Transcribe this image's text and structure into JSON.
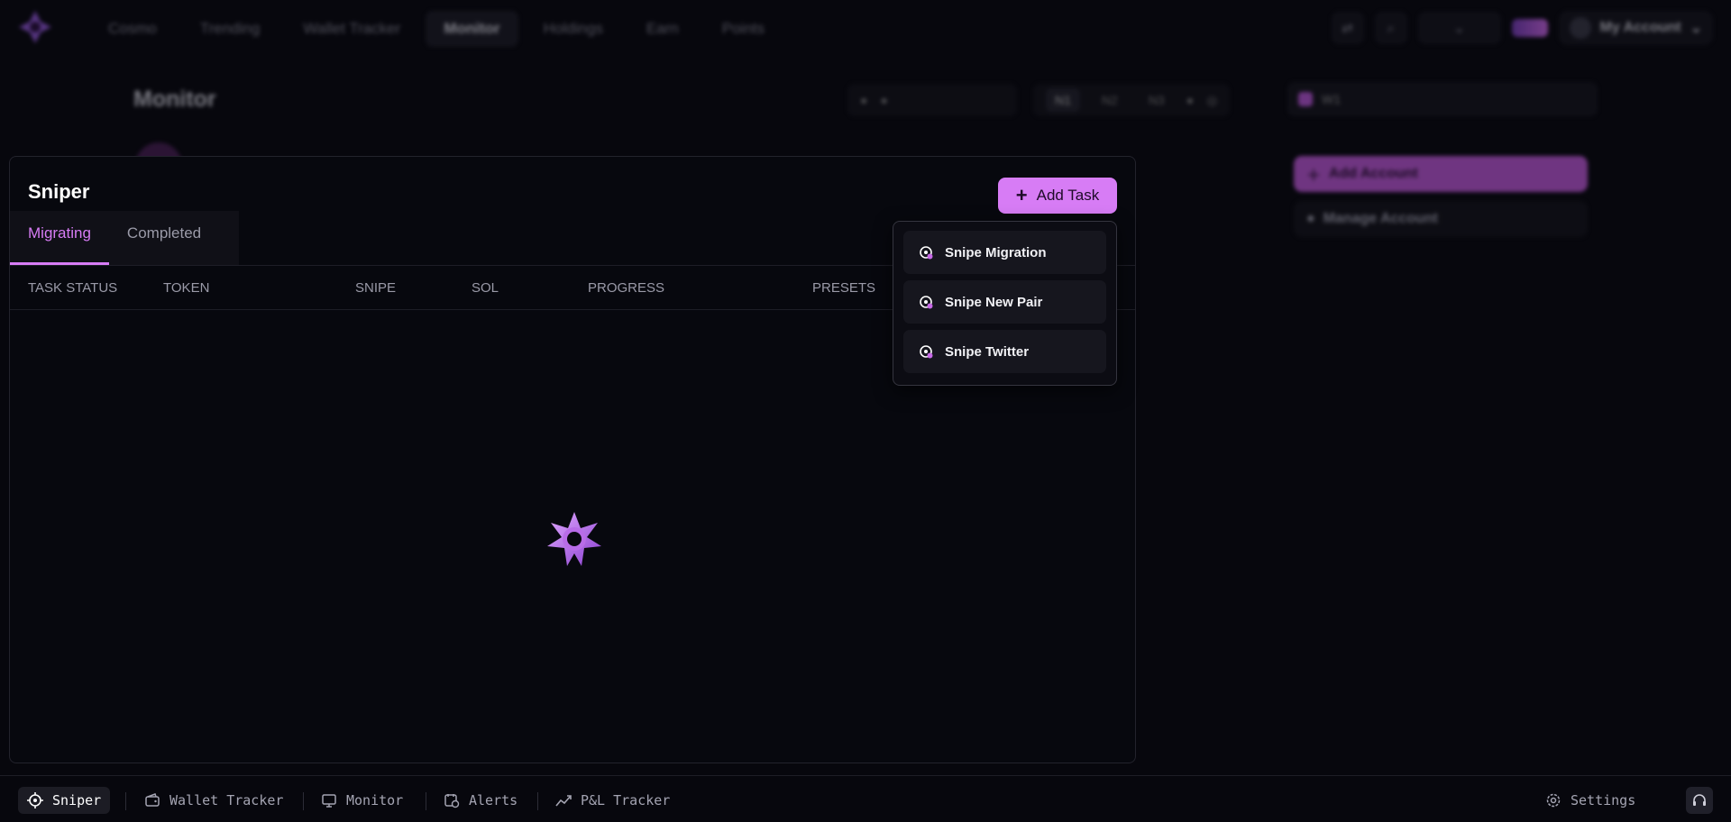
{
  "topnav": {
    "links": [
      {
        "label": "Cosmo"
      },
      {
        "label": "Trending"
      },
      {
        "label": "Wallet Tracker"
      },
      {
        "label": "Monitor"
      },
      {
        "label": "Holdings"
      },
      {
        "label": "Earn"
      },
      {
        "label": "Points"
      }
    ],
    "account_label": "My Account",
    "accent_color": "#d77cf5"
  },
  "monitor": {
    "title": "Monitor",
    "filter_segments": [
      "N1",
      "N2",
      "N3"
    ],
    "wallet_label": "W1",
    "add_account_label": "Add Account",
    "manage_account_label": "Manage Account"
  },
  "sniper": {
    "title": "Sniper",
    "add_task_label": "Add Task",
    "tabs": [
      {
        "label": "Migrating",
        "active": true
      },
      {
        "label": "Completed",
        "active": false
      }
    ],
    "columns": [
      "TASK STATUS",
      "TOKEN",
      "SNIPE",
      "SOL",
      "PROGRESS",
      "PRESETS"
    ],
    "menu_items": [
      {
        "label": "Snipe Migration",
        "icon": "target-icon"
      },
      {
        "label": "Snipe New Pair",
        "icon": "target-icon"
      },
      {
        "label": "Snipe Twitter",
        "icon": "target-icon"
      }
    ]
  },
  "bottombar": {
    "items": [
      {
        "label": "Sniper",
        "icon": "crosshair-icon",
        "active": true
      },
      {
        "label": "Wallet Tracker",
        "icon": "wallet-icon",
        "active": false
      },
      {
        "label": "Monitor",
        "icon": "monitor-icon",
        "active": false
      },
      {
        "label": "Alerts",
        "icon": "alarm-icon",
        "active": false
      },
      {
        "label": "P&L Tracker",
        "icon": "chart-icon",
        "active": false
      }
    ],
    "settings_label": "Settings"
  }
}
